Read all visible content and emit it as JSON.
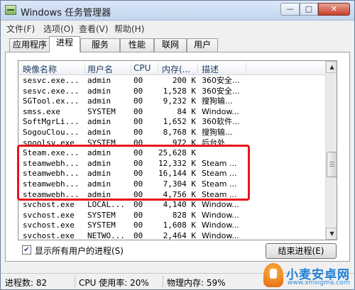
{
  "window": {
    "title": "Windows 任务管理器",
    "controls": {
      "minimize": "—",
      "maximize": "□",
      "close": "✕"
    }
  },
  "menu": [
    "文件(F)",
    "选项(O)",
    "查看(V)",
    "帮助(H)"
  ],
  "tabs": [
    {
      "label": "应用程序",
      "active": false
    },
    {
      "label": "进程",
      "active": true
    },
    {
      "label": "服务",
      "active": false
    },
    {
      "label": "性能",
      "active": false
    },
    {
      "label": "联网",
      "active": false
    },
    {
      "label": "用户",
      "active": false
    }
  ],
  "columns": [
    "映像名称",
    "用户名",
    "CPU",
    "内存(...",
    "描述"
  ],
  "rows": [
    {
      "name": "sesvc.exe...",
      "user": "admin",
      "cpu": "00",
      "mem": "200 K",
      "desc": "360安全..."
    },
    {
      "name": "sesvc.exe...",
      "user": "admin",
      "cpu": "00",
      "mem": "1,528 K",
      "desc": "360安全..."
    },
    {
      "name": "SGTool.ex...",
      "user": "admin",
      "cpu": "00",
      "mem": "9,232 K",
      "desc": "搜狗输..."
    },
    {
      "name": "smss.exe",
      "user": "SYSTEM",
      "cpu": "00",
      "mem": "84 K",
      "desc": "Window..."
    },
    {
      "name": "SoftMgrLi...",
      "user": "admin",
      "cpu": "00",
      "mem": "1,652 K",
      "desc": "360软件..."
    },
    {
      "name": "SogouClou...",
      "user": "admin",
      "cpu": "00",
      "mem": "8,768 K",
      "desc": "搜狗输..."
    },
    {
      "name": "spoolsv.exe",
      "user": "SYSTEM",
      "cpu": "00",
      "mem": "972 K",
      "desc": "后台处..."
    },
    {
      "name": "Steam.exe...",
      "user": "admin",
      "cpu": "00",
      "mem": "25,628 K",
      "desc": ""
    },
    {
      "name": "steamwebh...",
      "user": "admin",
      "cpu": "00",
      "mem": "12,332 K",
      "desc": "Steam ..."
    },
    {
      "name": "steamwebh...",
      "user": "admin",
      "cpu": "00",
      "mem": "16,144 K",
      "desc": "Steam ..."
    },
    {
      "name": "steamwebh...",
      "user": "admin",
      "cpu": "00",
      "mem": "7,304 K",
      "desc": "Steam ..."
    },
    {
      "name": "steamwebh...",
      "user": "admin",
      "cpu": "00",
      "mem": "4,756 K",
      "desc": "Steam ..."
    },
    {
      "name": "svchost.exe",
      "user": "LOCAL...",
      "cpu": "00",
      "mem": "4,140 K",
      "desc": "Window..."
    },
    {
      "name": "svchost.exe",
      "user": "SYSTEM",
      "cpu": "00",
      "mem": "828 K",
      "desc": "Window..."
    },
    {
      "name": "svchost.exe",
      "user": "SYSTEM",
      "cpu": "00",
      "mem": "1,608 K",
      "desc": "Window..."
    },
    {
      "name": "svchost.exe",
      "user": "NETWO...",
      "cpu": "00",
      "mem": "2,464 K",
      "desc": "Window..."
    }
  ],
  "show_all_users": {
    "label": "显示所有用户的进程(S)",
    "checked": "✔"
  },
  "end_process_button": "结束进程(E)",
  "status": {
    "process_count": "进程数: 82",
    "cpu_usage": "CPU 使用率: 20%",
    "memory": "物理内存: 59%"
  },
  "watermark": {
    "text": "小麦安卓网",
    "url": "www.xmsigma.com"
  },
  "colors": {
    "highlight": "#e8131b",
    "header_text": "#1e3a5f"
  },
  "icons": {
    "app": "task-manager-icon",
    "scroll_up": "▲",
    "scroll_down": "▼"
  }
}
